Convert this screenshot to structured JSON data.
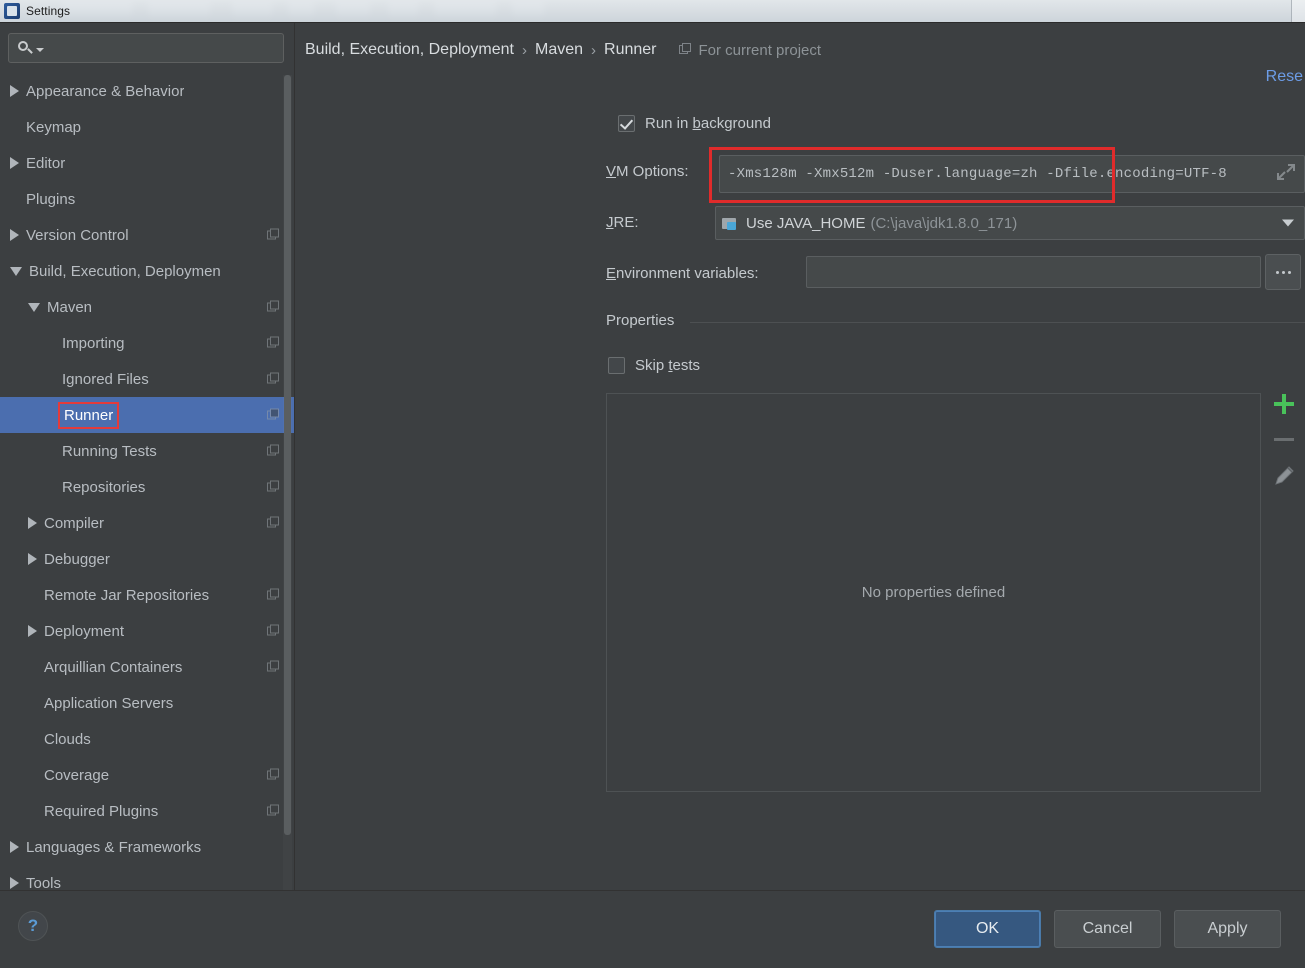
{
  "window": {
    "title": "Settings",
    "icon": "idea-app-icon"
  },
  "sidebar": {
    "search": {
      "value": "",
      "placeholder": ""
    },
    "items": [
      {
        "label": "Appearance & Behavior",
        "indent": 0,
        "arrow": "closed",
        "mod": false,
        "selected": false
      },
      {
        "label": "Keymap",
        "indent": 0,
        "arrow": "none",
        "mod": false,
        "selected": false
      },
      {
        "label": "Editor",
        "indent": 0,
        "arrow": "closed",
        "mod": false,
        "selected": false
      },
      {
        "label": "Plugins",
        "indent": 0,
        "arrow": "none",
        "mod": false,
        "selected": false
      },
      {
        "label": "Version Control",
        "indent": 0,
        "arrow": "closed",
        "mod": true,
        "selected": false
      },
      {
        "label": "Build, Execution, Deploymen",
        "indent": 0,
        "arrow": "open",
        "mod": false,
        "selected": false
      },
      {
        "label": "Maven",
        "indent": 1,
        "arrow": "open",
        "mod": true,
        "selected": false
      },
      {
        "label": "Importing",
        "indent": 2,
        "arrow": "none",
        "mod": true,
        "selected": false
      },
      {
        "label": "Ignored Files",
        "indent": 2,
        "arrow": "none",
        "mod": true,
        "selected": false
      },
      {
        "label": "Runner",
        "indent": 2,
        "arrow": "none",
        "mod": true,
        "selected": true
      },
      {
        "label": "Running Tests",
        "indent": 2,
        "arrow": "none",
        "mod": true,
        "selected": false
      },
      {
        "label": "Repositories",
        "indent": 2,
        "arrow": "none",
        "mod": true,
        "selected": false
      },
      {
        "label": "Compiler",
        "indent": 1,
        "arrow": "closed",
        "mod": true,
        "selected": false
      },
      {
        "label": "Debugger",
        "indent": 1,
        "arrow": "closed",
        "mod": false,
        "selected": false
      },
      {
        "label": "Remote Jar Repositories",
        "indent": 1,
        "arrow": "none",
        "mod": true,
        "selected": false
      },
      {
        "label": "Deployment",
        "indent": 1,
        "arrow": "closed",
        "mod": true,
        "selected": false
      },
      {
        "label": "Arquillian Containers",
        "indent": 1,
        "arrow": "none",
        "mod": true,
        "selected": false
      },
      {
        "label": "Application Servers",
        "indent": 1,
        "arrow": "none",
        "mod": false,
        "selected": false
      },
      {
        "label": "Clouds",
        "indent": 1,
        "arrow": "none",
        "mod": false,
        "selected": false
      },
      {
        "label": "Coverage",
        "indent": 1,
        "arrow": "none",
        "mod": true,
        "selected": false
      },
      {
        "label": "Required Plugins",
        "indent": 1,
        "arrow": "none",
        "mod": true,
        "selected": false
      },
      {
        "label": "Languages & Frameworks",
        "indent": 0,
        "arrow": "closed",
        "mod": false,
        "selected": false
      },
      {
        "label": "Tools",
        "indent": 0,
        "arrow": "closed",
        "mod": false,
        "selected": false
      }
    ]
  },
  "header": {
    "crumb1": "Build, Execution, Deployment",
    "sep1": "›",
    "crumb2": "Maven",
    "sep2": "›",
    "crumb3": "Runner",
    "scope_label": "For current project",
    "reset_label": "Rese"
  },
  "form": {
    "run_in_background": {
      "label_pre": "Run in ",
      "label_key": "b",
      "label_post": "ackground",
      "checked": true
    },
    "vm_options": {
      "label_key": "V",
      "label_post": "M Options:",
      "value": "-Xms128m -Xmx512m -Duser.language=zh -Dfile.encoding=UTF-8",
      "expand_icon": "expand-icon"
    },
    "jre": {
      "label_key": "J",
      "label_post": "RE:",
      "value": "Use JAVA_HOME",
      "path": "(C:\\java\\jdk1.8.0_171)",
      "icon": "java-home-icon",
      "dropdown_icon": "chevron-down-icon"
    },
    "env_vars": {
      "label_key": "E",
      "label_post": "nvironment variables:",
      "value": "",
      "browse_label": "..."
    },
    "properties": {
      "section_title": "Properties",
      "skip_tests": {
        "label_pre": "Skip ",
        "label_key": "t",
        "label_post": "ests",
        "checked": false
      },
      "empty_text": "No properties defined",
      "toolbar": [
        {
          "name": "add-property-button",
          "icon": "plus-icon",
          "enabled": true
        },
        {
          "name": "remove-property-button",
          "icon": "minus-icon",
          "enabled": false
        },
        {
          "name": "edit-property-button",
          "icon": "pencil-icon",
          "enabled": false
        }
      ]
    }
  },
  "footer": {
    "help_label": "?",
    "ok_label": "OK",
    "cancel_label": "Cancel",
    "apply_label": "Apply"
  },
  "colors": {
    "bg": "#3c3f41",
    "selection": "#4b6eaf",
    "accent_link": "#6c9ce6",
    "annotation_red": "#e02b2b",
    "add_green": "#49c25a",
    "primary_button": "#365880"
  }
}
